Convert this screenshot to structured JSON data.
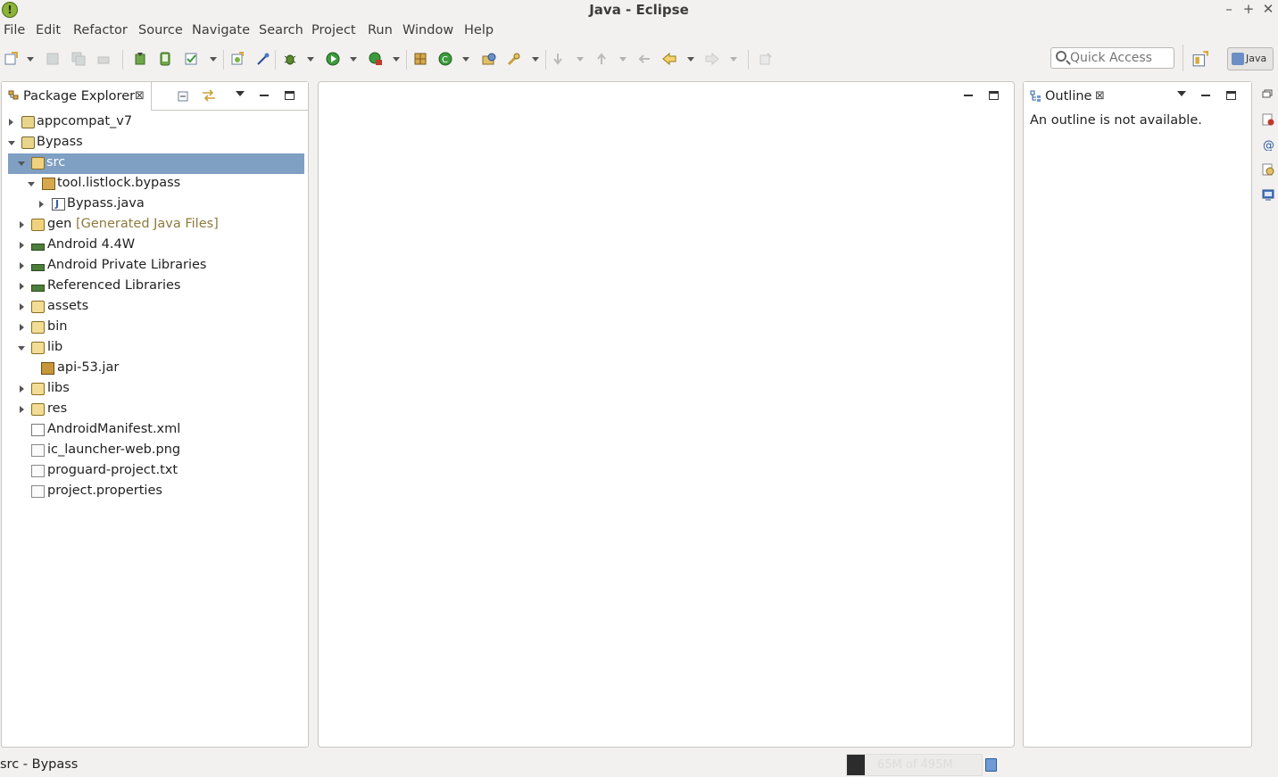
{
  "window": {
    "title": "Java - Eclipse"
  },
  "menubar": [
    "File",
    "Edit",
    "Refactor",
    "Source",
    "Navigate",
    "Search",
    "Project",
    "Run",
    "Window",
    "Help"
  ],
  "toolbar": {
    "quick_access_placeholder": "Quick Access",
    "perspective_label": "Java"
  },
  "package_explorer": {
    "tab_label": "Package Explorer",
    "items": [
      {
        "label": "appcompat_v7"
      },
      {
        "label": "Bypass"
      },
      {
        "label": "src"
      },
      {
        "label": "tool.listlock.bypass"
      },
      {
        "label": "Bypass.java"
      },
      {
        "label": "gen",
        "decoration": "[Generated Java Files]"
      },
      {
        "label": "Android 4.4W"
      },
      {
        "label": "Android Private Libraries"
      },
      {
        "label": "Referenced Libraries"
      },
      {
        "label": "assets"
      },
      {
        "label": "bin"
      },
      {
        "label": "lib"
      },
      {
        "label": "api-53.jar"
      },
      {
        "label": "libs"
      },
      {
        "label": "res"
      },
      {
        "label": "AndroidManifest.xml"
      },
      {
        "label": "ic_launcher-web.png"
      },
      {
        "label": "proguard-project.txt"
      },
      {
        "label": "project.properties"
      }
    ],
    "selected_item": "src"
  },
  "outline": {
    "tab_label": "Outline",
    "message": "An outline is not available."
  },
  "status": {
    "text": "src - Bypass",
    "heap_text": "65M of 495M",
    "heap_used_fraction": 0.13
  },
  "colors": {
    "selection": "#7f9fc3",
    "decoration": "#8d7a3e"
  }
}
